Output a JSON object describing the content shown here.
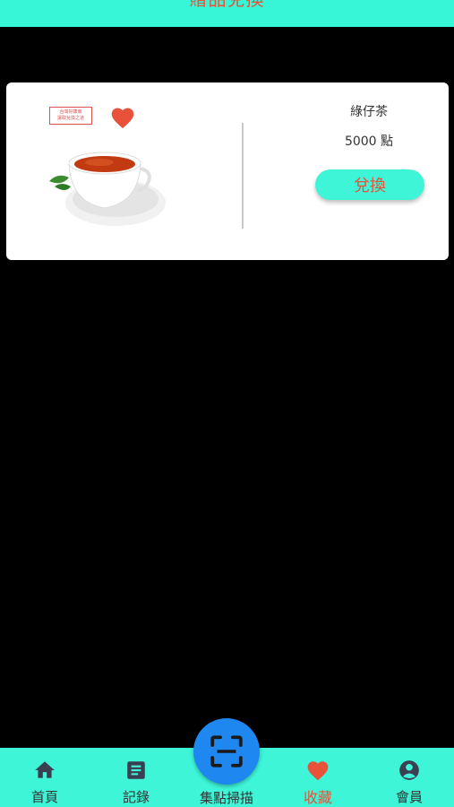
{
  "header": {
    "title": "贈品兌換"
  },
  "product": {
    "stamp_line1": "台灣好康東",
    "stamp_line2": "讓取兌換之道",
    "name": "綠仔茶",
    "points": "5000 點",
    "redeem_label": "兌換"
  },
  "nav": {
    "items": [
      {
        "label": "首頁",
        "icon": "home-icon"
      },
      {
        "label": "記錄",
        "icon": "record-icon"
      },
      {
        "label": "集點掃描",
        "icon": "scan-icon"
      },
      {
        "label": "收藏",
        "icon": "heart-icon"
      },
      {
        "label": "會員",
        "icon": "member-icon"
      }
    ]
  },
  "colors": {
    "accent": "#3ef5d7",
    "highlight": "#e8513a",
    "scan": "#1e88f0"
  }
}
